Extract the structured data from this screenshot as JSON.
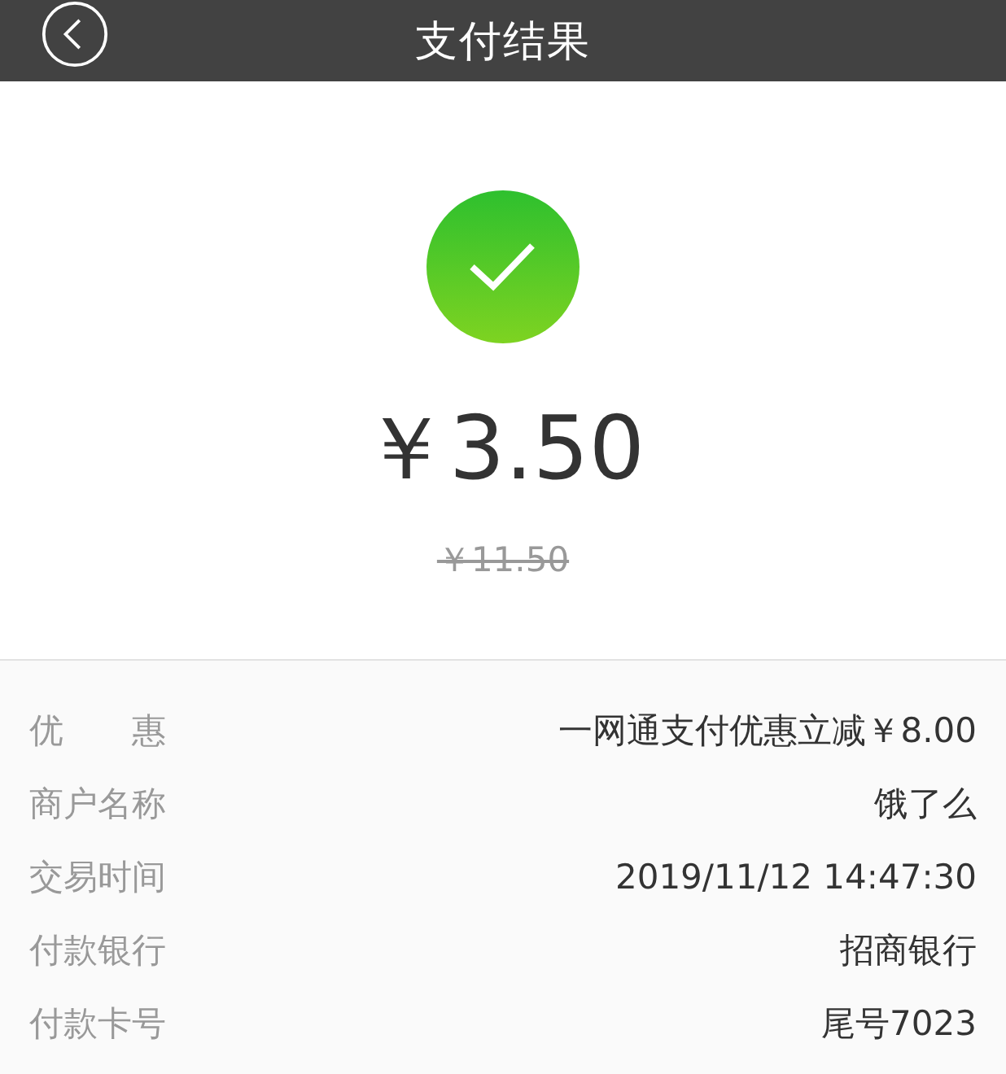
{
  "header": {
    "title": "支付结果"
  },
  "result": {
    "success": true,
    "amount": "￥3.50",
    "original_amount": "￥11.50"
  },
  "details": [
    {
      "label": "优　　惠",
      "value": "一网通支付优惠立减￥8.00"
    },
    {
      "label": "商户名称",
      "value": "饿了么"
    },
    {
      "label": "交易时间",
      "value": "2019/11/12 14:47:30"
    },
    {
      "label": "付款银行",
      "value": "招商银行"
    },
    {
      "label": "付款卡号",
      "value": "尾号7023"
    }
  ]
}
